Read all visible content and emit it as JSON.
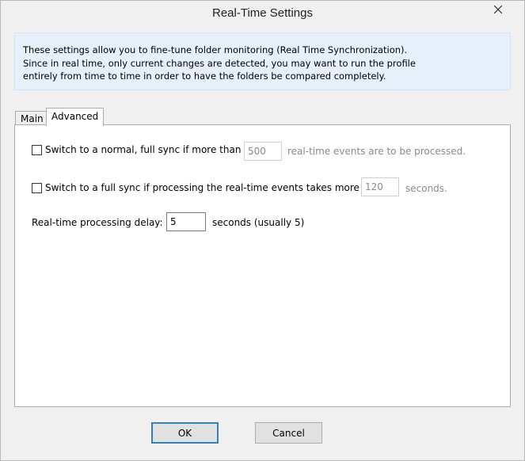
{
  "window": {
    "title": "Real-Time Settings"
  },
  "info": {
    "line1": "These settings allow you to fine-tune folder monitoring (Real Time Synchronization).",
    "line2": "Since in real time, only current changes are detected, you may want to run the profile",
    "line3": "entirely from time to time in order to have the folders be compared completely."
  },
  "tabs": {
    "main": "Main",
    "advanced": "Advanced"
  },
  "options": {
    "full_sync_events": {
      "label": "Switch to a normal, full sync if more than",
      "value": "500",
      "suffix": "real-time events are to be processed.",
      "checked": false
    },
    "full_sync_time": {
      "label": "Switch to a full sync if processing the real-time events takes more than",
      "value": "120",
      "suffix": "seconds.",
      "checked": false
    },
    "delay": {
      "label": "Real-time processing delay:",
      "value": "5",
      "suffix": "seconds  (usually 5)"
    }
  },
  "buttons": {
    "ok": "OK",
    "cancel": "Cancel"
  }
}
